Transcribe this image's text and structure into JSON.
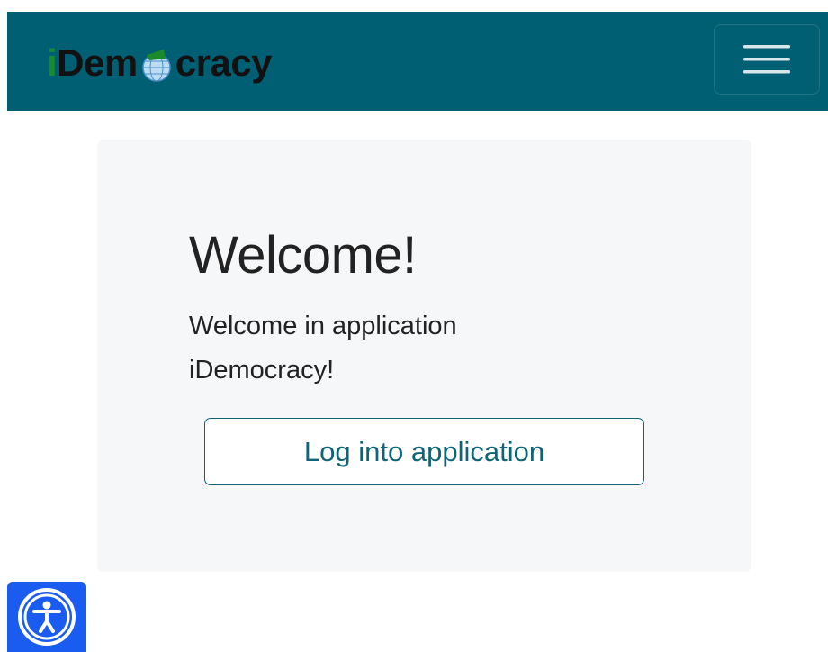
{
  "navbar": {
    "brand": {
      "prefix": "i",
      "part1": "Dem",
      "part2": "cracy",
      "logo_icon": "globe-with-green-cap-icon"
    },
    "menu_toggle_icon": "hamburger-menu-icon"
  },
  "card": {
    "title": "Welcome!",
    "text": "Welcome in application iDemocracy!",
    "login_button_label": "Log into application"
  },
  "accessibility": {
    "icon": "accessibility-person-icon"
  },
  "colors": {
    "navbar_bg": "#005f73",
    "brand_i": "#1a8a2a",
    "brand_text": "#111111",
    "card_bg": "#f6f7f9",
    "button_accent": "#0f6475",
    "a11y_bg": "#1a5cf0"
  }
}
